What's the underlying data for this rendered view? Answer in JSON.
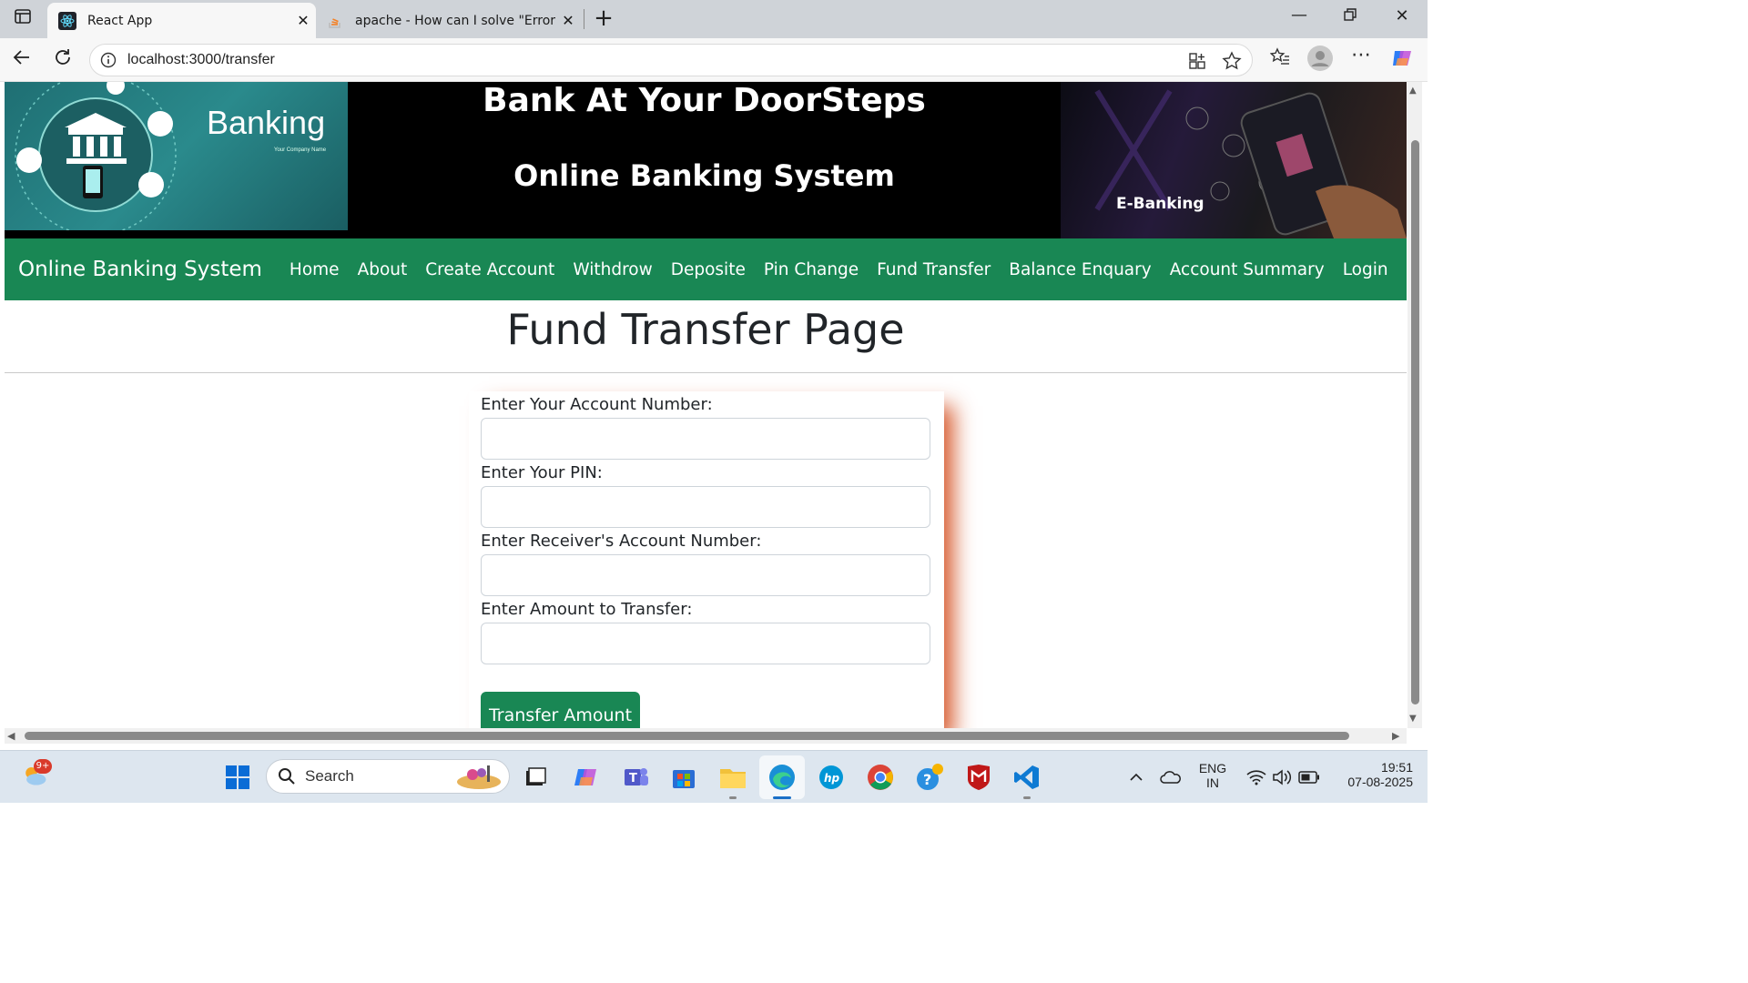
{
  "browser": {
    "tabs": [
      {
        "label": "React App",
        "icon": "react-icon",
        "active": true
      },
      {
        "label": "apache - How can I solve \"Error: M",
        "icon": "stackoverflow-icon",
        "active": false
      }
    ],
    "url": "localhost:3000/transfer"
  },
  "banner": {
    "logo_text": "Banking",
    "logo_subtext": "Your Company Name",
    "heading": "Bank At Your DoorSteps",
    "subheading": "Online Banking System",
    "right_label": "E-Banking"
  },
  "navbar": {
    "brand": "Online Banking System",
    "links": [
      "Home",
      "About",
      "Create Account",
      "Withdrow",
      "Deposite",
      "Pin Change",
      "Fund Transfer",
      "Balance Enquary",
      "Account Summary",
      "Login"
    ]
  },
  "page": {
    "title": "Fund Transfer Page"
  },
  "form": {
    "fields": [
      {
        "label": "Enter Your Account Number:",
        "value": ""
      },
      {
        "label": "Enter Your PIN:",
        "value": ""
      },
      {
        "label": "Enter Receiver's Account Number:",
        "value": ""
      },
      {
        "label": "Enter Amount to Transfer:",
        "value": ""
      }
    ],
    "submit_label": "Transfer Amount"
  },
  "taskbar": {
    "search_label": "Search",
    "weather_badge": "9+",
    "lang_line1": "ENG",
    "lang_line2": "IN",
    "time": "19:51",
    "date": "07-08-2025"
  },
  "colors": {
    "navbar_bg": "#198754",
    "button_bg": "#198754",
    "banner_bg": "#000000",
    "card_shadow": "#d24614"
  }
}
